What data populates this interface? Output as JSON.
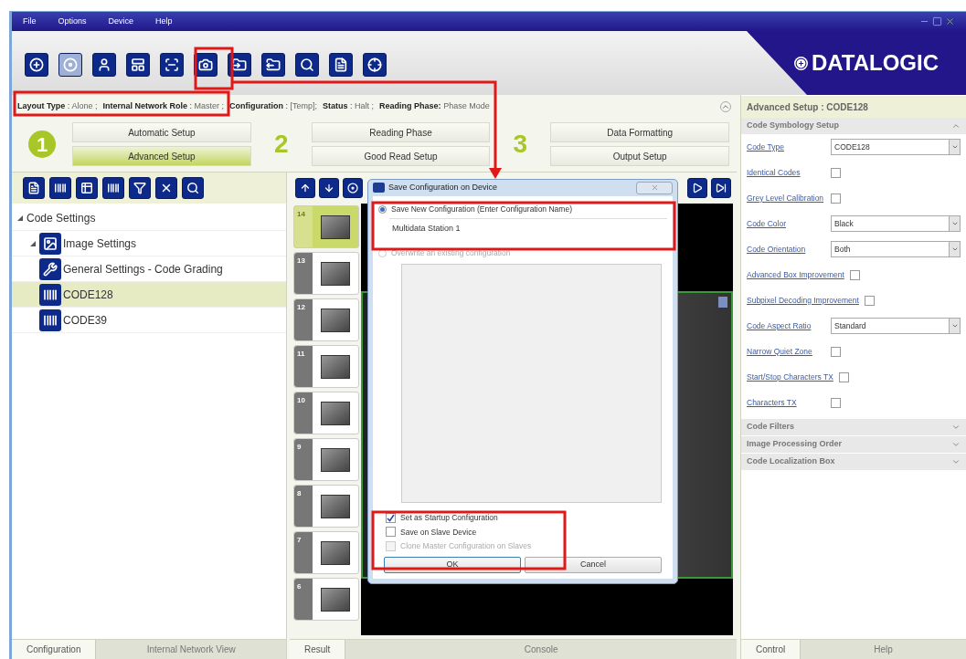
{
  "menu": [
    "File",
    "Options",
    "Device",
    "Help"
  ],
  "logo": "DATALOGIC",
  "status": [
    {
      "label": "Layout Type",
      "sep": ":",
      "value": "Alone ;"
    },
    {
      "label": "Internal Network Role",
      "sep": ":",
      "value": "Master ;"
    },
    {
      "label": "Configuration",
      "sep": ":",
      "value": "[Temp];"
    },
    {
      "label": "Status",
      "sep": ":",
      "value": "Halt ;"
    },
    {
      "label": "Reading Phase:",
      "value": "Phase Mode"
    }
  ],
  "setup_groups": [
    {
      "number": "1",
      "kind": "circle",
      "buttons": [
        {
          "label": "Automatic Setup",
          "selected": false
        },
        {
          "label": "Advanced Setup",
          "selected": true
        }
      ]
    },
    {
      "number": "2",
      "kind": "plain",
      "buttons": [
        {
          "label": "Reading Phase",
          "selected": false
        },
        {
          "label": "Good Read Setup",
          "selected": false
        }
      ]
    },
    {
      "number": "3",
      "kind": "plain",
      "buttons": [
        {
          "label": "Data Formatting",
          "selected": false
        },
        {
          "label": "Output Setup",
          "selected": false
        }
      ]
    }
  ],
  "tree": [
    {
      "label": "Code Settings",
      "expanded": true,
      "selected": false,
      "children": [
        {
          "label": "Image Settings",
          "kind": "image",
          "expanded": true,
          "selected": false
        },
        {
          "label": "General Settings - Code Grading",
          "kind": "wrench",
          "selected": false
        },
        {
          "label": "CODE128",
          "kind": "barcode",
          "selected": true
        },
        {
          "label": "CODE39",
          "kind": "barcode",
          "selected": false
        }
      ]
    }
  ],
  "left_tabs": [
    {
      "label": "Configuration",
      "selected": true
    },
    {
      "label": "Internal Network View",
      "selected": false
    }
  ],
  "frames": [
    {
      "number": "14",
      "selected": true
    },
    {
      "number": "13",
      "selected": false
    },
    {
      "number": "12",
      "selected": false
    },
    {
      "number": "11",
      "selected": false
    },
    {
      "number": "10",
      "selected": false
    },
    {
      "number": "9",
      "selected": false
    },
    {
      "number": "8",
      "selected": false
    },
    {
      "number": "7",
      "selected": false
    },
    {
      "number": "6",
      "selected": false
    }
  ],
  "middle_tabs": [
    {
      "label": "Result",
      "selected": true
    },
    {
      "label": "Console",
      "selected": false
    }
  ],
  "right": {
    "title": "Advanced Setup :  CODE128",
    "section": {
      "label": "Code Symbology Setup",
      "expanded": true
    },
    "fields": [
      {
        "kind": "select",
        "label": "Code Type",
        "value": "CODE128"
      },
      {
        "kind": "checkbox",
        "label": "Identical Codes",
        "checked": false
      },
      {
        "kind": "checkbox",
        "label": "Grey Level Calibration",
        "checked": false
      },
      {
        "kind": "select",
        "label": "Code Color",
        "value": "Black"
      },
      {
        "kind": "select",
        "label": "Code Orientation",
        "value": "Both"
      },
      {
        "kind": "checkbox",
        "label": "Advanced Box Improvement",
        "checked": false
      },
      {
        "kind": "checkbox",
        "label": "Subpixel Decoding Improvement",
        "checked": false
      },
      {
        "kind": "select",
        "label": "Code Aspect Ratio",
        "value": "Standard"
      },
      {
        "kind": "checkbox",
        "label": "Narrow Quiet Zone",
        "checked": false
      },
      {
        "kind": "checkbox",
        "label": "Start/Stop Characters TX",
        "checked": false
      },
      {
        "kind": "checkbox",
        "label": "Characters TX",
        "checked": false
      }
    ],
    "collapsed_sections": [
      {
        "label": "Code Filters",
        "expanded": false
      },
      {
        "label": "Image Processing Order",
        "expanded": false
      },
      {
        "label": "Code Localization Box",
        "expanded": false
      }
    ],
    "tabs": [
      {
        "label": "Control",
        "selected": true
      },
      {
        "label": "Help",
        "selected": false
      }
    ]
  },
  "dialog": {
    "title": "Save Configuration on Device",
    "options": [
      {
        "label": "Save New Configuration (Enter Configuration Name)",
        "selected": true,
        "disabled": false
      },
      {
        "label": "Overwrite an existing configuration",
        "selected": false,
        "disabled": true
      }
    ],
    "name_value": "Multidata Station 1",
    "checks": [
      {
        "label": "Set as Startup Configuration",
        "checked": true,
        "disabled": false
      },
      {
        "label": "Save on Slave Device",
        "checked": false,
        "disabled": false
      },
      {
        "label": "Clone Master Configuration on Slaves",
        "checked": false,
        "disabled": true
      }
    ],
    "buttons": [
      "OK",
      "Cancel"
    ]
  }
}
